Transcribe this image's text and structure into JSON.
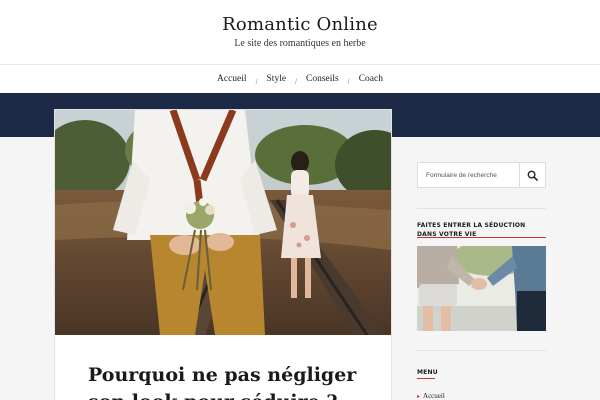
{
  "header": {
    "site_title": "Romantic Online",
    "tagline": "Le site des romantiques en herbe"
  },
  "nav": {
    "items": [
      {
        "label": "Accueil"
      },
      {
        "label": "Style"
      },
      {
        "label": "Conseils"
      },
      {
        "label": "Coach"
      }
    ],
    "separator": "/"
  },
  "colors": {
    "dark_band": "#1c2a47",
    "accent": "#c0392b"
  },
  "article": {
    "title": "Pourquoi ne pas négliger son look pour séduire ?",
    "image_icon": "photo-couple-railway"
  },
  "sidebar": {
    "search": {
      "placeholder": "Formulaire de recherche",
      "button_icon": "search-icon"
    },
    "widget_title": "FAITES ENTRER LA SÉDUCTION DANS VOTRE VIE",
    "widget_image_icon": "photo-couple-holding-hands",
    "menu": {
      "title": "MENU",
      "items": [
        {
          "label": "Accueil"
        }
      ],
      "arrow": "▸"
    }
  }
}
